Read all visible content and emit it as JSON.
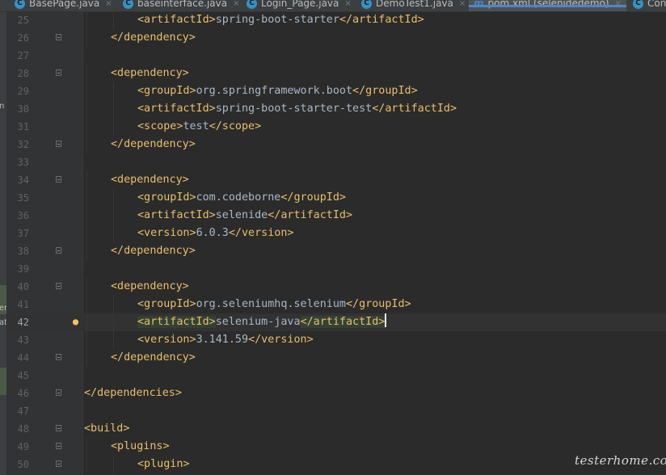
{
  "tabs": [
    {
      "label": "BasePage.java",
      "icon": "java-class-icon",
      "active": false
    },
    {
      "label": "baseinterface.java",
      "icon": "java-class-icon",
      "active": false
    },
    {
      "label": "Login_Page.java",
      "icon": "java-class-icon",
      "active": false
    },
    {
      "label": "DemoTest1.java",
      "icon": "java-class-icon",
      "active": false
    },
    {
      "label": "pom.xml (selenidedemo)",
      "icon": "maven-icon",
      "active": true
    },
    {
      "label": "Con",
      "icon": "java-class-icon",
      "active": false
    }
  ],
  "tab_icon_letter": "C",
  "maven_icon_letter": "m",
  "close_glyph": "×",
  "left_strip_texts": [
    "n",
    "er",
    "at"
  ],
  "editor": {
    "current_line": 42,
    "lines": [
      {
        "n": "25",
        "indent": 2,
        "tokens": [
          {
            "t": "tag",
            "v": "<artifactId>"
          },
          {
            "t": "text",
            "v": "spring-boot-starter"
          },
          {
            "t": "tag",
            "v": "</artifactId>"
          }
        ]
      },
      {
        "n": "26",
        "indent": 1,
        "fold": true,
        "tokens": [
          {
            "t": "tag",
            "v": "</dependency>"
          }
        ]
      },
      {
        "n": "27",
        "indent": 0,
        "tokens": []
      },
      {
        "n": "28",
        "indent": 1,
        "fold": true,
        "tokens": [
          {
            "t": "tag",
            "v": "<dependency>"
          }
        ]
      },
      {
        "n": "29",
        "indent": 2,
        "tokens": [
          {
            "t": "tag",
            "v": "<groupId>"
          },
          {
            "t": "text",
            "v": "org.springframework.boot"
          },
          {
            "t": "tag",
            "v": "</groupId>"
          }
        ]
      },
      {
        "n": "30",
        "indent": 2,
        "tokens": [
          {
            "t": "tag",
            "v": "<artifactId>"
          },
          {
            "t": "text",
            "v": "spring-boot-starter-test"
          },
          {
            "t": "tag",
            "v": "</artifactId>"
          }
        ]
      },
      {
        "n": "31",
        "indent": 2,
        "tokens": [
          {
            "t": "tag",
            "v": "<scope>"
          },
          {
            "t": "text",
            "v": "test"
          },
          {
            "t": "tag",
            "v": "</scope>"
          }
        ]
      },
      {
        "n": "32",
        "indent": 1,
        "fold": true,
        "tokens": [
          {
            "t": "tag",
            "v": "</dependency>"
          }
        ]
      },
      {
        "n": "33",
        "indent": 0,
        "tokens": []
      },
      {
        "n": "34",
        "indent": 1,
        "fold": true,
        "tokens": [
          {
            "t": "tag",
            "v": "<dependency>"
          }
        ]
      },
      {
        "n": "35",
        "indent": 2,
        "tokens": [
          {
            "t": "tag",
            "v": "<groupId>"
          },
          {
            "t": "text",
            "v": "com.codeborne"
          },
          {
            "t": "tag",
            "v": "</groupId>"
          }
        ]
      },
      {
        "n": "36",
        "indent": 2,
        "tokens": [
          {
            "t": "tag",
            "v": "<artifactId>"
          },
          {
            "t": "text",
            "v": "selenide"
          },
          {
            "t": "tag",
            "v": "</artifactId>"
          }
        ]
      },
      {
        "n": "37",
        "indent": 2,
        "tokens": [
          {
            "t": "tag",
            "v": "<version>"
          },
          {
            "t": "text",
            "v": "6.0.3"
          },
          {
            "t": "tag",
            "v": "</version>"
          }
        ]
      },
      {
        "n": "38",
        "indent": 1,
        "fold": true,
        "tokens": [
          {
            "t": "tag",
            "v": "</dependency>"
          }
        ]
      },
      {
        "n": "39",
        "indent": 0,
        "tokens": []
      },
      {
        "n": "40",
        "indent": 1,
        "fold": true,
        "tokens": [
          {
            "t": "tag",
            "v": "<dependency>"
          }
        ]
      },
      {
        "n": "41",
        "indent": 2,
        "tokens": [
          {
            "t": "tag",
            "v": "<groupId>"
          },
          {
            "t": "text",
            "v": "org.seleniumhq.selenium"
          },
          {
            "t": "tag",
            "v": "</groupId>"
          }
        ]
      },
      {
        "n": "42",
        "indent": 2,
        "bulb": true,
        "tokens": [
          {
            "t": "tag",
            "v": "<artifactId>",
            "hl": true
          },
          {
            "t": "text",
            "v": "selenium-java"
          },
          {
            "t": "tag",
            "v": "</artifactId>",
            "hl": true
          },
          {
            "t": "caret"
          }
        ]
      },
      {
        "n": "43",
        "indent": 2,
        "tokens": [
          {
            "t": "tag",
            "v": "<version>"
          },
          {
            "t": "text",
            "v": "3.141.59"
          },
          {
            "t": "tag",
            "v": "</version>"
          }
        ]
      },
      {
        "n": "44",
        "indent": 1,
        "fold": true,
        "tokens": [
          {
            "t": "tag",
            "v": "</dependency>"
          }
        ]
      },
      {
        "n": "45",
        "indent": 0,
        "tokens": []
      },
      {
        "n": "46",
        "indent": 0,
        "fold": true,
        "tokens": [
          {
            "t": "tag",
            "v": "</dependencies>"
          }
        ]
      },
      {
        "n": "47",
        "indent": 0,
        "tokens": []
      },
      {
        "n": "48",
        "indent": 0,
        "fold": true,
        "tokens": [
          {
            "t": "tag",
            "v": "<build>"
          }
        ]
      },
      {
        "n": "49",
        "indent": 1,
        "fold": true,
        "tokens": [
          {
            "t": "tag",
            "v": "<plugins>"
          }
        ]
      },
      {
        "n": "50",
        "indent": 2,
        "fold": true,
        "tokens": [
          {
            "t": "tag",
            "v": "<plugin>"
          }
        ]
      }
    ]
  },
  "watermark": "testerhome.com",
  "colors": {
    "editor_bg": "#2b2b2b",
    "gutter_bg": "#313335",
    "tag": "#e8bf6a",
    "text": "#a9b7c6",
    "line_number": "#606366",
    "active_tab_underline": "#4a88c7",
    "matched_tag_bg": "#344134"
  }
}
